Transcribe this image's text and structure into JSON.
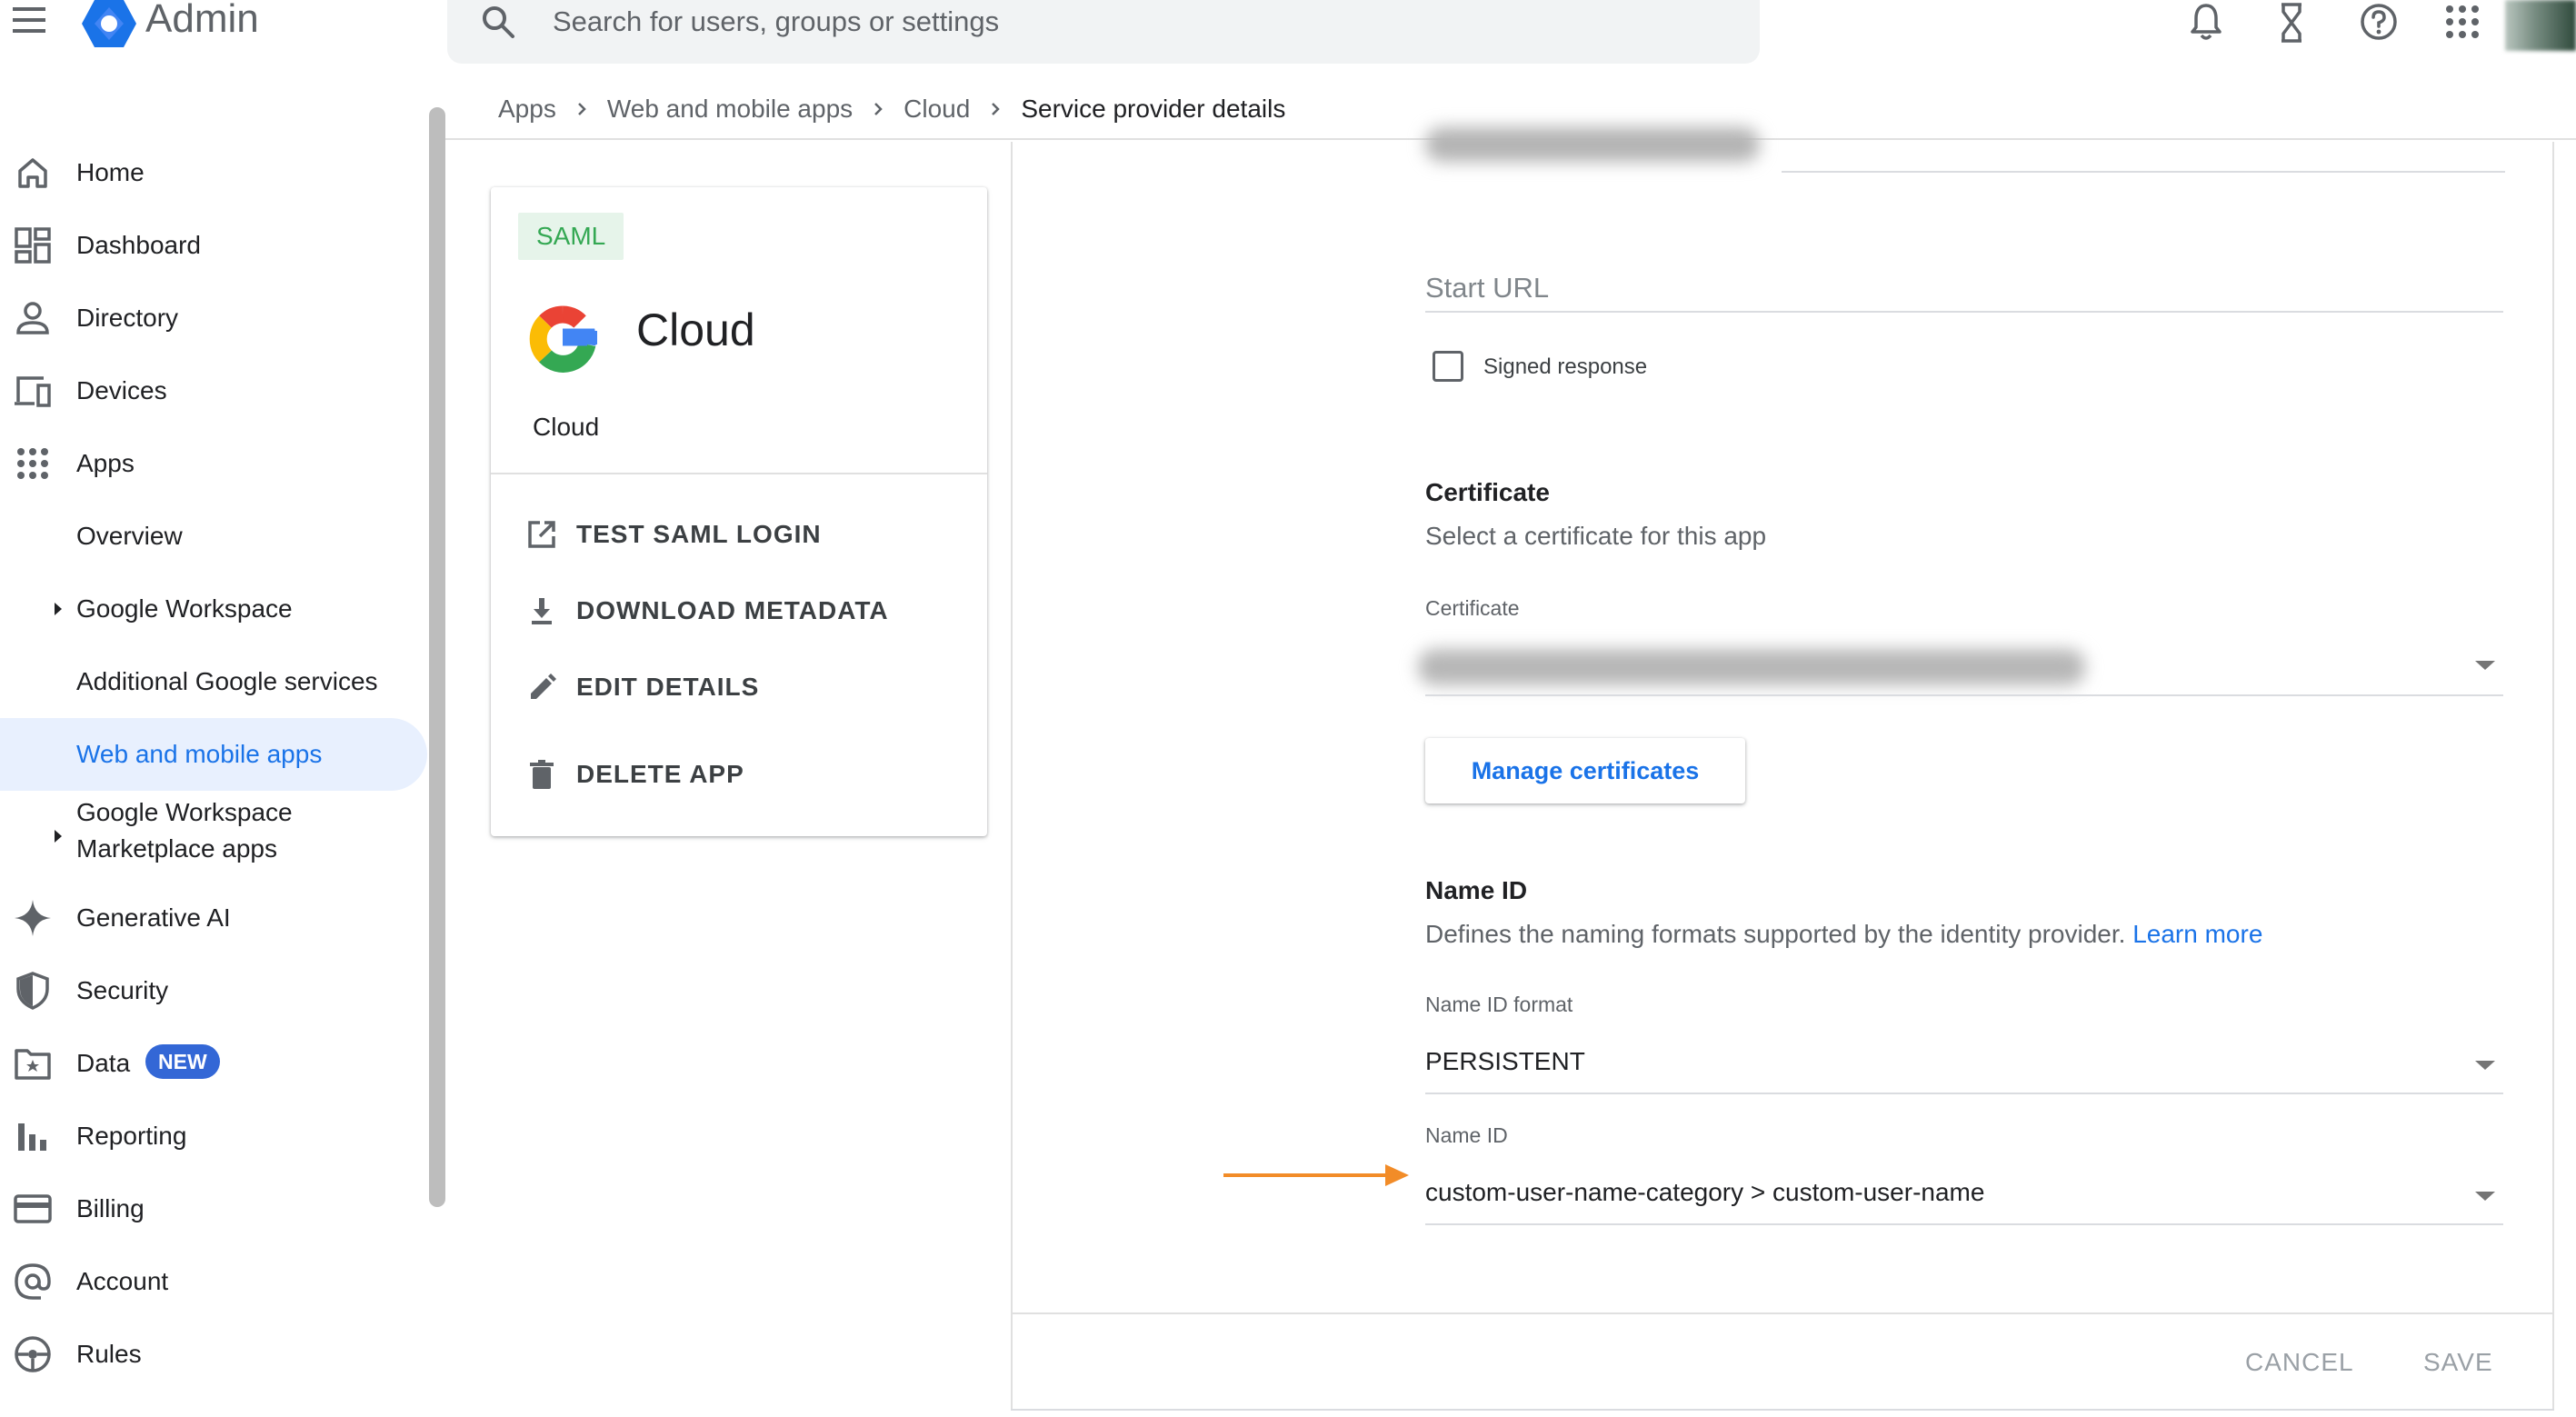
{
  "header": {
    "app_title": "Admin",
    "search_placeholder": "Search for users, groups or settings",
    "icons": [
      "menu-icon",
      "admin-logo-icon",
      "search-icon",
      "bell-icon",
      "hourglass-icon",
      "help-icon",
      "apps-grid-icon"
    ]
  },
  "breadcrumb": {
    "items": [
      "Apps",
      "Web and mobile apps",
      "Cloud"
    ],
    "current": "Service provider details"
  },
  "sidebar": {
    "items": [
      {
        "label": "Home",
        "icon": "home-icon"
      },
      {
        "label": "Dashboard",
        "icon": "dashboard-icon"
      },
      {
        "label": "Directory",
        "icon": "person-icon"
      },
      {
        "label": "Devices",
        "icon": "devices-icon"
      },
      {
        "label": "Apps",
        "icon": "apps-icon"
      },
      {
        "label": "Overview"
      },
      {
        "label": "Google Workspace",
        "caret": true
      },
      {
        "label": "Additional Google services"
      },
      {
        "label": "Web and mobile apps",
        "active": true
      },
      {
        "label": "Google Workspace",
        "label2": "Marketplace apps",
        "caret": true
      },
      {
        "label": "Generative AI",
        "icon": "sparkle-icon"
      },
      {
        "label": "Security",
        "icon": "shield-icon"
      },
      {
        "label": "Data",
        "icon": "data-folder-icon",
        "badge": "NEW"
      },
      {
        "label": "Reporting",
        "icon": "bar-chart-icon"
      },
      {
        "label": "Billing",
        "icon": "credit-card-icon"
      },
      {
        "label": "Account",
        "icon": "at-sign-icon"
      },
      {
        "label": "Rules",
        "icon": "rules-icon"
      }
    ],
    "accent_color": "#1a73e8",
    "active_bg": "#e8f0fe",
    "badge_color": "#3367d6"
  },
  "app_card": {
    "badge": "SAML",
    "name": "Cloud",
    "subtitle": "Cloud",
    "actions": [
      {
        "label": "TEST SAML LOGIN",
        "icon": "open-external-icon"
      },
      {
        "label": "DOWNLOAD METADATA",
        "icon": "download-icon"
      },
      {
        "label": "EDIT DETAILS",
        "icon": "pencil-icon"
      },
      {
        "label": "DELETE APP",
        "icon": "trash-icon"
      }
    ]
  },
  "form": {
    "start_url_placeholder": "Start URL",
    "signed_response_label": "Signed response",
    "signed_response_checked": false,
    "certificate": {
      "title": "Certificate",
      "description": "Select a certificate for this app",
      "field_label": "Certificate",
      "manage_button": "Manage certificates"
    },
    "name_id": {
      "title": "Name ID",
      "description": "Defines the naming formats supported by the identity provider.",
      "learn_more": "Learn more",
      "format_label": "Name ID format",
      "format_value": "PERSISTENT",
      "name_id_label": "Name ID",
      "name_id_value": "custom-user-name-category > custom-user-name"
    }
  },
  "footer": {
    "cancel": "CANCEL",
    "save": "SAVE"
  },
  "colors": {
    "highlight_arrow": "#f28c28",
    "link": "#1a73e8",
    "saml_badge_bg": "#e6f4ea",
    "saml_badge_text": "#34a853"
  }
}
